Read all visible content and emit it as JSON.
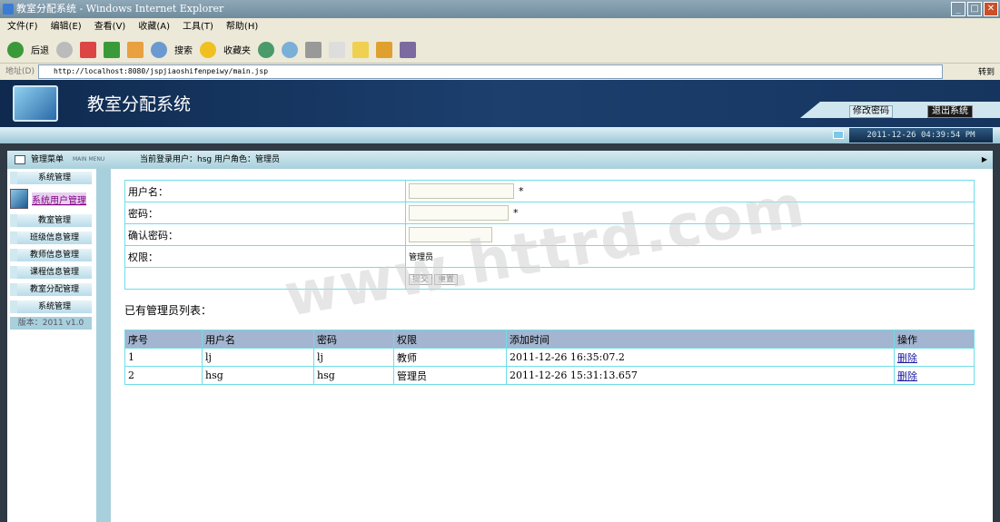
{
  "window": {
    "title": "教室分配系统 - Windows Internet Explorer"
  },
  "menubar": [
    "文件(F)",
    "编辑(E)",
    "查看(V)",
    "收藏(A)",
    "工具(T)",
    "帮助(H)"
  ],
  "toolbar": {
    "back": "后退",
    "search": "搜索",
    "favorites": "收藏夹"
  },
  "address": {
    "label": "地址(D)",
    "url": "http://localhost:8080/jspjiaoshifenpeiwy/main.jsp",
    "go": "转到"
  },
  "header": {
    "app_title": "教室分配系统",
    "change_password": "修改密码",
    "logout": "退出系统",
    "datetime": "2011-12-26 04:39:54 PM"
  },
  "menu_header": {
    "title": "管理菜单",
    "subtitle": "MAIN MENU",
    "user_info": "当前登录用户：hsg  用户角色：管理员"
  },
  "sidebar": {
    "items": [
      "系统管理",
      "系统用户管理",
      "教室管理",
      "班级信息管理",
      "教师信息管理",
      "课程信息管理",
      "教室分配管理",
      "系统管理"
    ],
    "version": "版本：2011 v1.0"
  },
  "form": {
    "username_label": "用户名：",
    "password_label": "密码：",
    "confirm_label": "确认密码：",
    "role_label": "权限：",
    "role_value": "管理员",
    "required": "*",
    "submit": "提交",
    "reset": "重置"
  },
  "list": {
    "title": "已有管理员列表：",
    "columns": [
      "序号",
      "用户名",
      "密码",
      "权限",
      "添加时间",
      "操作"
    ],
    "rows": [
      [
        "1",
        "lj",
        "lj",
        "教师",
        "2011-12-26 16:35:07.2",
        "删除"
      ],
      [
        "2",
        "hsg",
        "hsg",
        "管理员",
        "2011-12-26 15:31:13.657",
        "删除"
      ]
    ]
  },
  "watermark": "www.httrd.com"
}
